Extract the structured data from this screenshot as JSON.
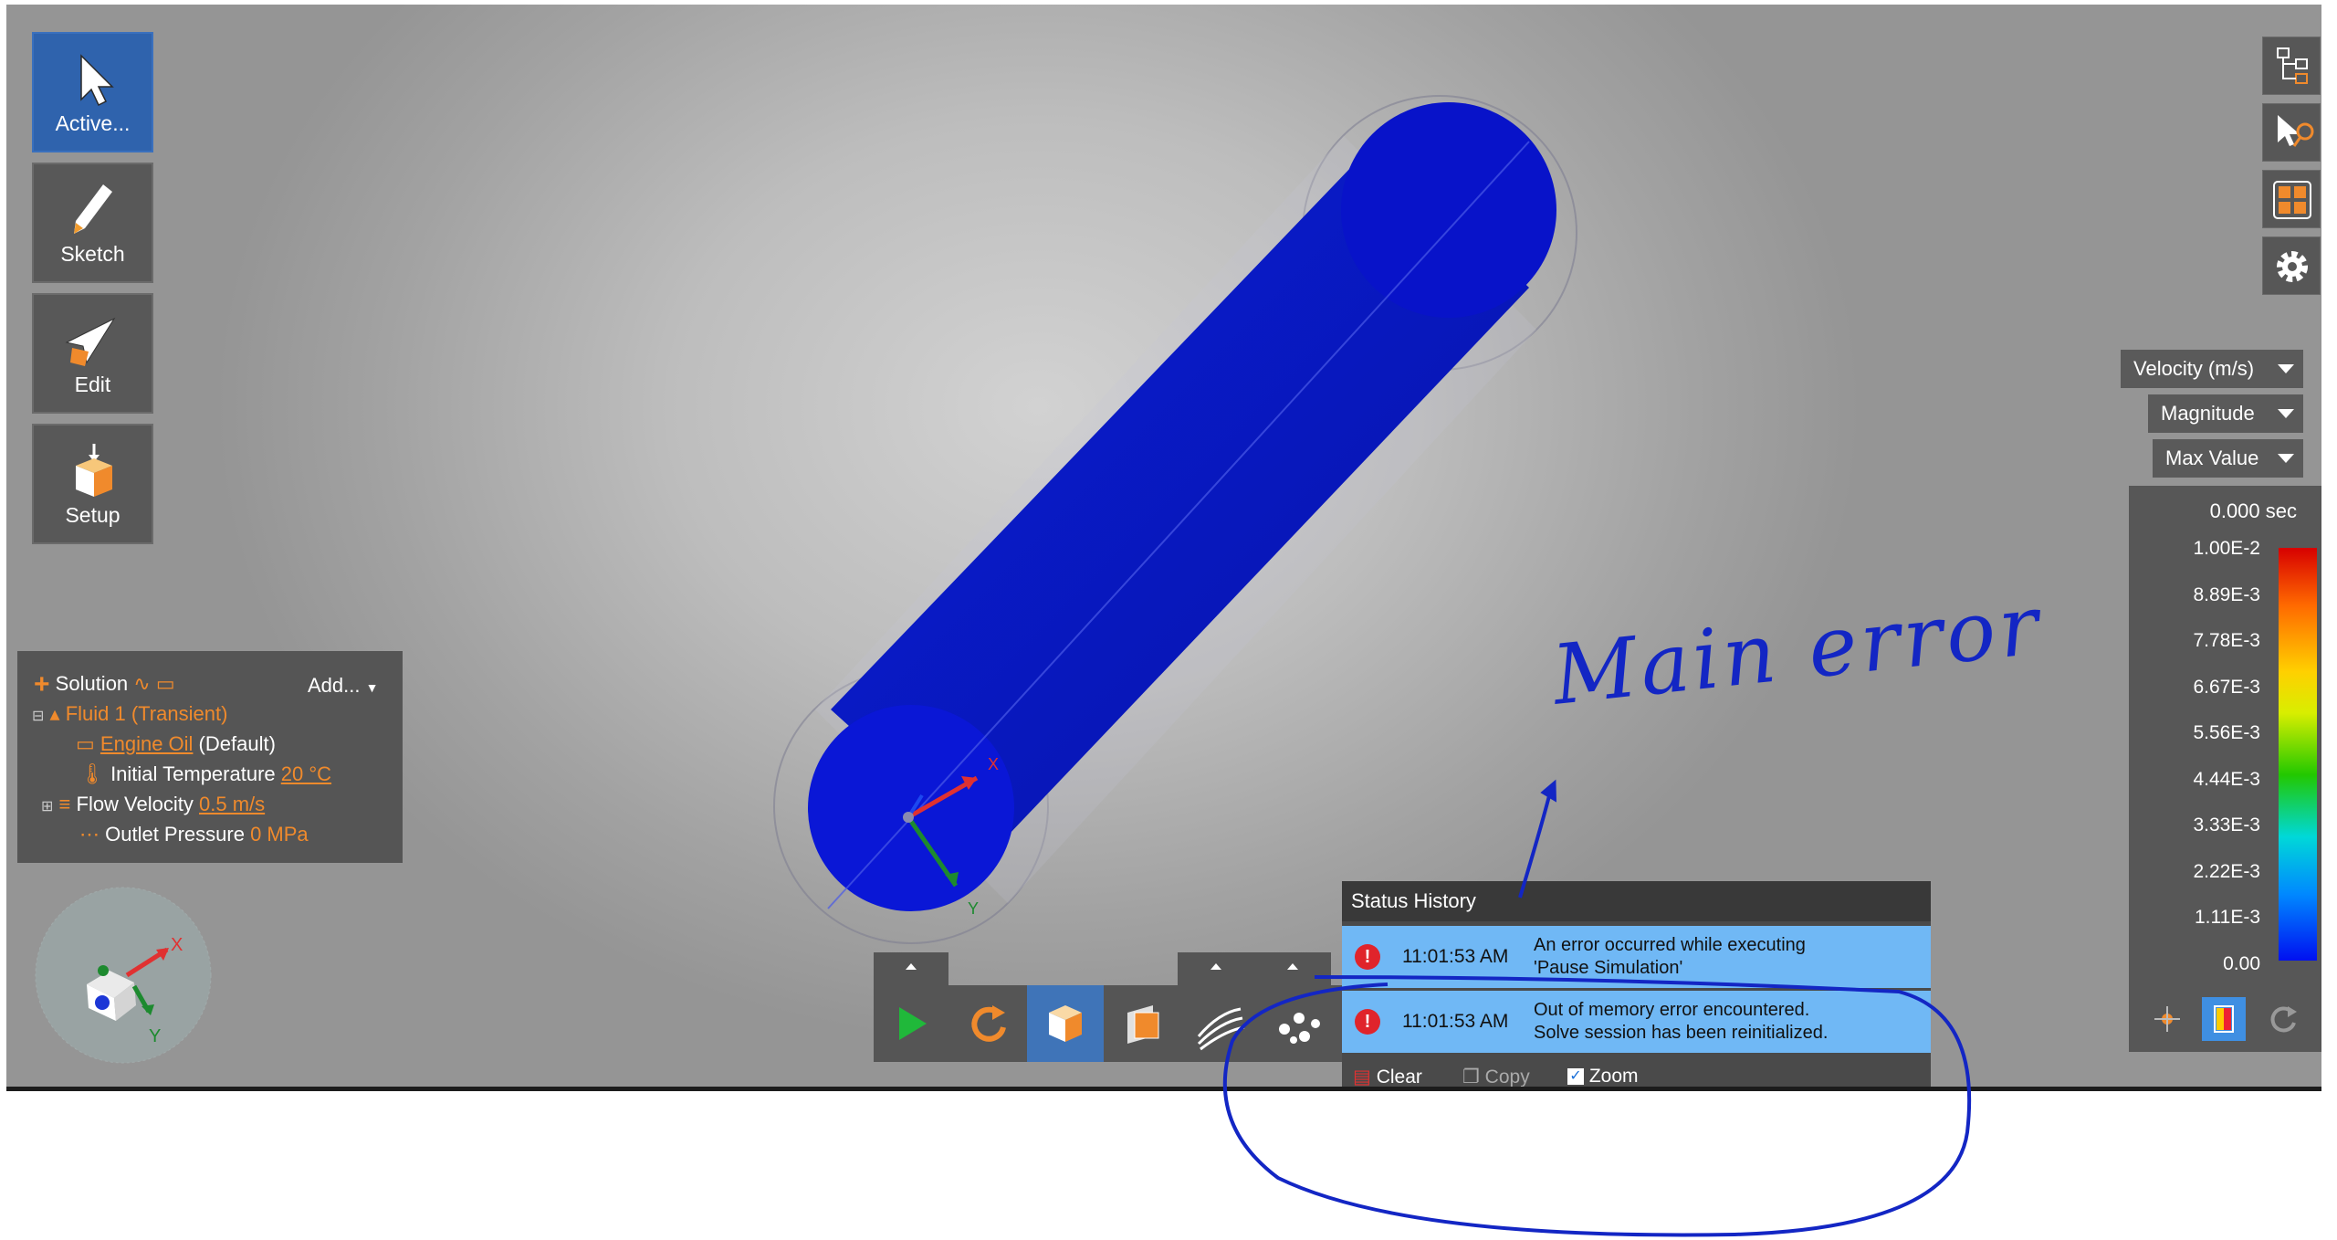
{
  "left_tools": [
    {
      "label": "Active...",
      "icon": "cursor-arrow-icon"
    },
    {
      "label": "Sketch",
      "icon": "pencil-icon"
    },
    {
      "label": "Edit",
      "icon": "edit-arrow-icon"
    },
    {
      "label": "Setup",
      "icon": "setup-box-icon"
    }
  ],
  "right_icons": [
    "structure-tree-icon",
    "select-pointer-icon",
    "display-options-icon",
    "settings-gear-icon"
  ],
  "results": {
    "quantity": "Velocity (m/s)",
    "component": "Magnitude",
    "mode": "Max Value"
  },
  "legend": {
    "time": "0.000 sec",
    "ticks": [
      "1.00E-2",
      "8.89E-3",
      "7.78E-3",
      "6.67E-3",
      "5.56E-3",
      "4.44E-3",
      "3.33E-3",
      "2.22E-3",
      "1.11E-3",
      "0.00"
    ]
  },
  "tree": {
    "solution_label": "Solution",
    "add_label": "Add...",
    "fluid_label": "Fluid 1 (Transient)",
    "material_name": "Engine Oil",
    "material_suffix": " (Default)",
    "temp_label": "Initial Temperature ",
    "temp_value": "20 °C",
    "velocity_label": "Flow Velocity ",
    "velocity_value": "0.5 m/s",
    "pressure_label": "Outlet Pressure ",
    "pressure_value": "0 MPa"
  },
  "triad": {
    "x": "X",
    "y": "Y"
  },
  "toolbar_icons": [
    "play-icon",
    "reset-icon",
    "solid-view-icon",
    "section-view-icon",
    "streamlines-icon",
    "particles-icon"
  ],
  "status": {
    "title": "Status History",
    "rows": [
      {
        "time": "11:01:53 AM",
        "line1": "An error occurred while executing",
        "line2": "'Pause Simulation'"
      },
      {
        "time": "11:01:53 AM",
        "line1": "Out of memory error encountered.",
        "line2": "Solve session has been reinitialized."
      }
    ],
    "clear_label": "Clear",
    "copy_label": "Copy",
    "zoom_label": "Zoom"
  },
  "annotation_text": "Main error"
}
